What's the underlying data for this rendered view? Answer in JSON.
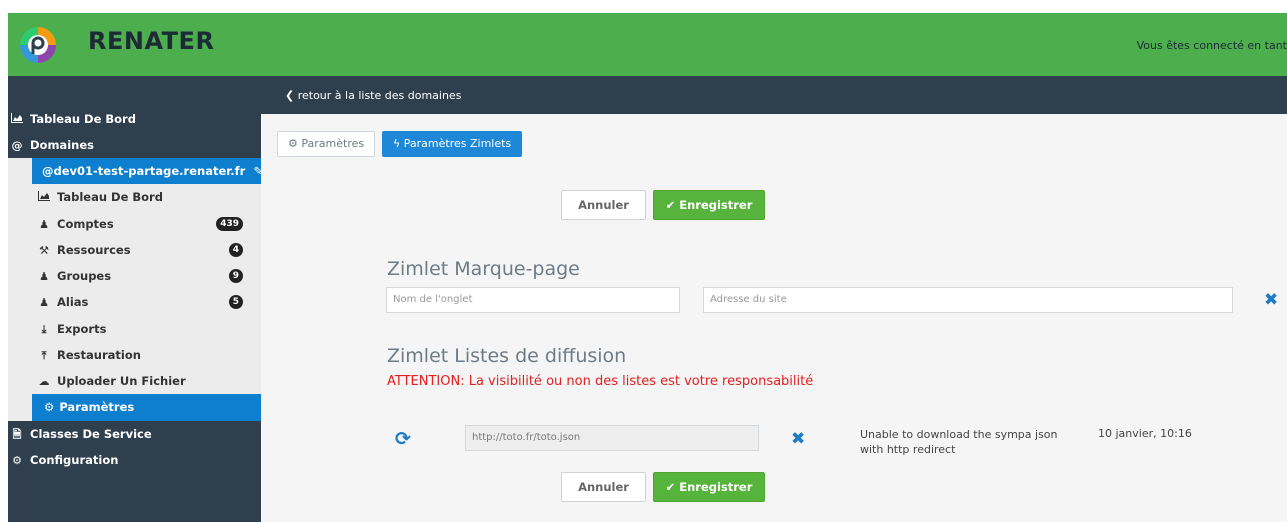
{
  "header": {
    "brand": "RENATER",
    "connected_text": "Vous êtes connecté en tant",
    "brand_color": "#4cae4c"
  },
  "sidebar": {
    "items": [
      {
        "label": "Tableau De Bord",
        "icon": "area-chart-icon"
      },
      {
        "label": "Domaines",
        "icon": "at-icon"
      },
      {
        "label": "Classes De Service",
        "icon": "file-icon"
      },
      {
        "label": "Configuration",
        "icon": "cogs-icon"
      }
    ],
    "domain": {
      "label": "@dev01-test-partage.renater.fr",
      "icon": "edit-icon"
    },
    "subitems": [
      {
        "label": "Tableau De Bord",
        "icon": "area-chart-icon",
        "badge": ""
      },
      {
        "label": "Comptes",
        "icon": "user-icon",
        "badge": "439"
      },
      {
        "label": "Ressources",
        "icon": "wrench-icon",
        "badge": "4"
      },
      {
        "label": "Groupes",
        "icon": "users-icon",
        "badge": "9"
      },
      {
        "label": "Alias",
        "icon": "user-plus-icon",
        "badge": "5"
      },
      {
        "label": "Exports",
        "icon": "download-icon",
        "badge": ""
      },
      {
        "label": "Restauration",
        "icon": "upload-icon",
        "badge": ""
      },
      {
        "label": "Uploader Un Fichier",
        "icon": "cloud-upload-icon",
        "badge": ""
      },
      {
        "label": "Paramètres",
        "icon": "cog-icon",
        "badge": ""
      }
    ]
  },
  "subheader": {
    "back_label": "retour à la liste des domaines"
  },
  "tabs": [
    {
      "label": "Paramètres",
      "active": false
    },
    {
      "label": "Paramètres Zimlets",
      "active": true
    }
  ],
  "actions": {
    "cancel_label": "Annuler",
    "save_label": "Enregistrer"
  },
  "bookmark": {
    "title": "Zimlet Marque-page",
    "tab_name_placeholder": "Nom de l'onglet",
    "site_url_placeholder": "Adresse du site"
  },
  "lists": {
    "title": "Zimlet Listes de diffusion",
    "warning": "ATTENTION: La visibilité ou non des listes est votre responsabilité",
    "rows": [
      {
        "url": "http://toto.fr/toto.json",
        "status": "Unable to download the sympa json with http redirect",
        "date": "10 janvier, 10:16"
      }
    ]
  },
  "colors": {
    "accent": "#1e88d6",
    "success": "#56b33b",
    "warning": "#e02020",
    "nav_dark": "#2f3f4e"
  }
}
